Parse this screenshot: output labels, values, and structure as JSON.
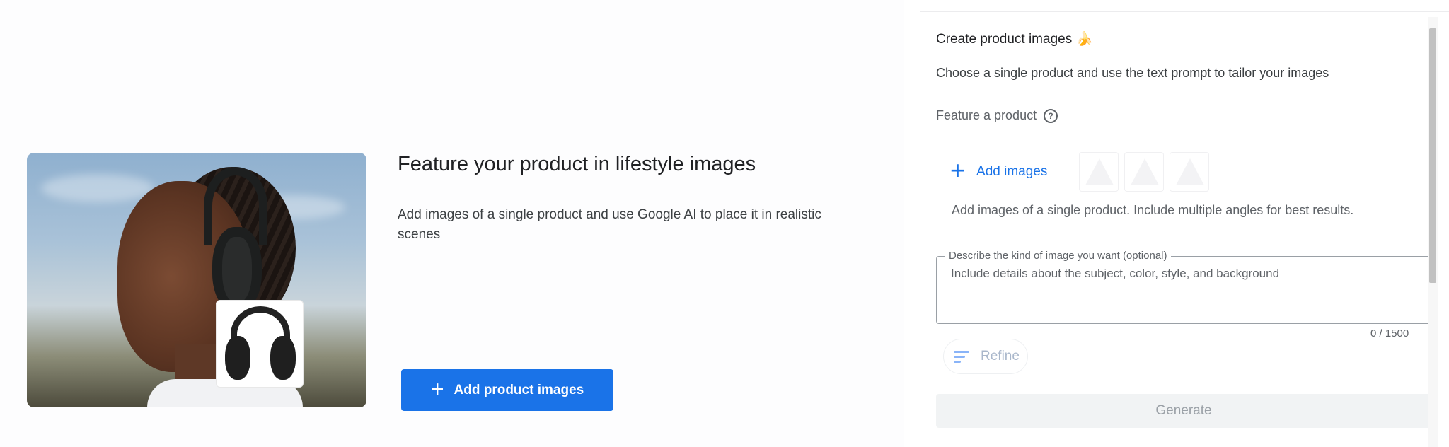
{
  "hero": {
    "title": "Feature your product in lifestyle images",
    "description": "Add images of a single product and use Google AI to place it in realistic scenes",
    "cta_label": "Add product images",
    "cta_icon": "plus-icon"
  },
  "panel": {
    "title": "Create product images",
    "title_emoji": "🍌",
    "subtitle": "Choose a single product and use the text prompt to tailor your images",
    "feature_label": "Feature a product",
    "help_icon": "help-circle-icon",
    "add_images_label": "Add images",
    "helper_text": "Add images of a single product. Include multiple angles for best results.",
    "prompt": {
      "label": "Describe the kind of image you want (optional)",
      "placeholder": "Include details about the subject, color, style, and background",
      "value": "",
      "counter": "0 / 1500"
    },
    "refine_label": "Refine",
    "refine_icon": "refine-edit-icon",
    "generate_label": "Generate"
  },
  "colors": {
    "primary": "#1a73e8",
    "disabled_bg": "#f1f3f4",
    "disabled_text": "#9aa0a6"
  }
}
